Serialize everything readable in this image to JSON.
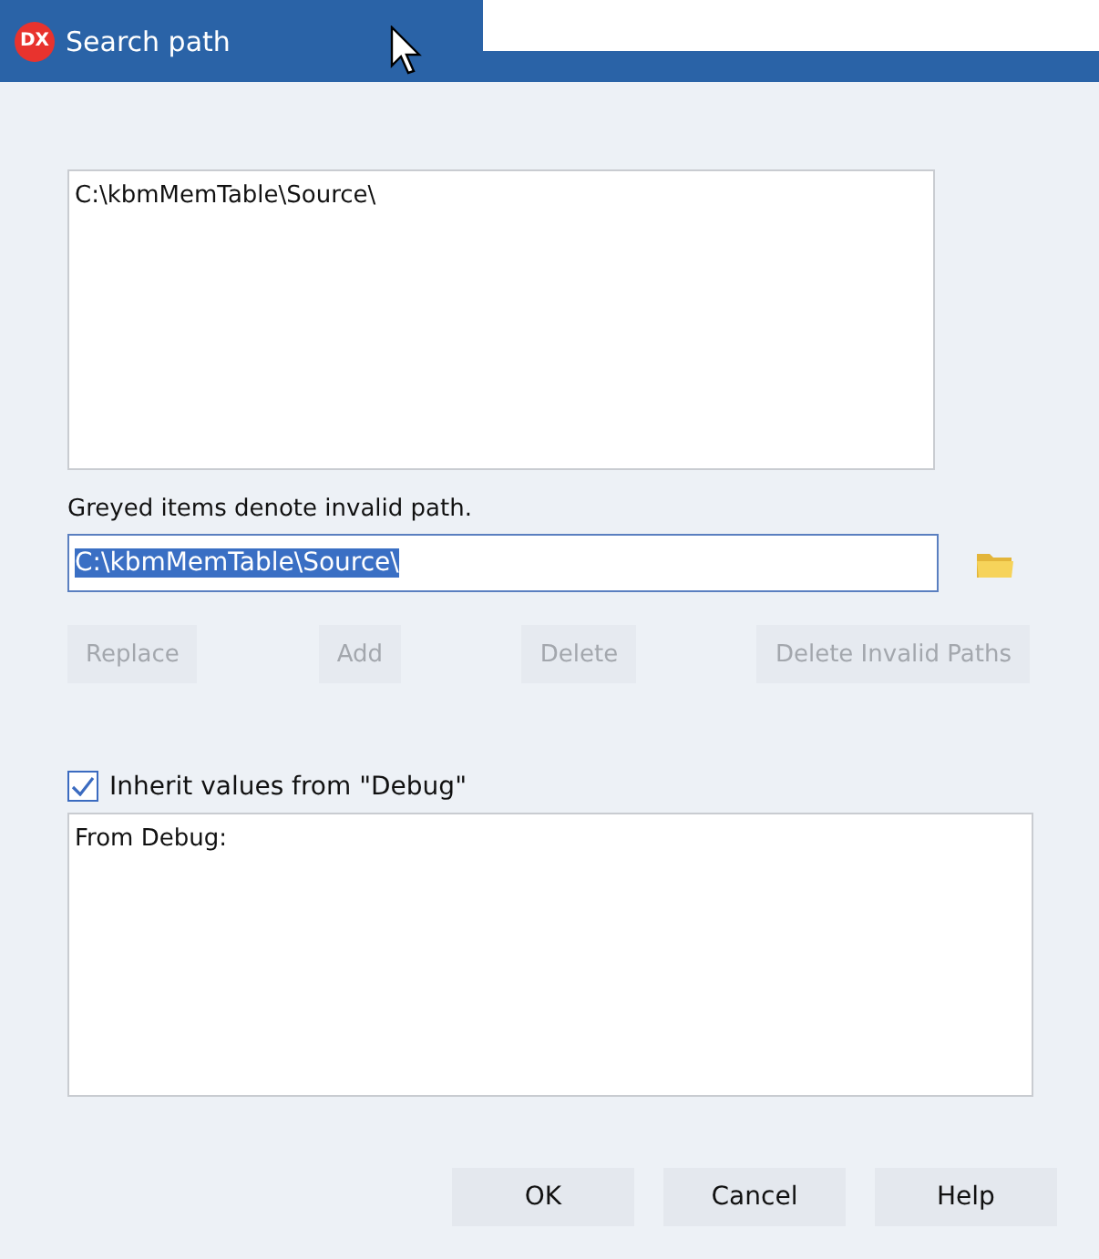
{
  "window": {
    "title": "Search path",
    "logo": "DX"
  },
  "path_list": {
    "items": [
      {
        "text": "C:\\kbmMemTable\\Source\\",
        "greyed": false
      }
    ]
  },
  "hint": "Greyed items denote invalid path.",
  "path_field": {
    "value": "C:\\kbmMemTable\\Source\\",
    "selected": true
  },
  "actions": [
    {
      "label": "Replace",
      "disabled": true
    },
    {
      "label": "Add",
      "disabled": true
    },
    {
      "label": "Delete",
      "disabled": true
    },
    {
      "label": "Delete Invalid Paths",
      "disabled": true
    }
  ],
  "inherit": {
    "label": "Inherit values from \"Debug\"",
    "checked": true
  },
  "inherited_list": {
    "items": [
      "From Debug:"
    ]
  },
  "buttons": [
    {
      "label": "OK"
    },
    {
      "label": "Cancel"
    },
    {
      "label": "Help"
    }
  ]
}
